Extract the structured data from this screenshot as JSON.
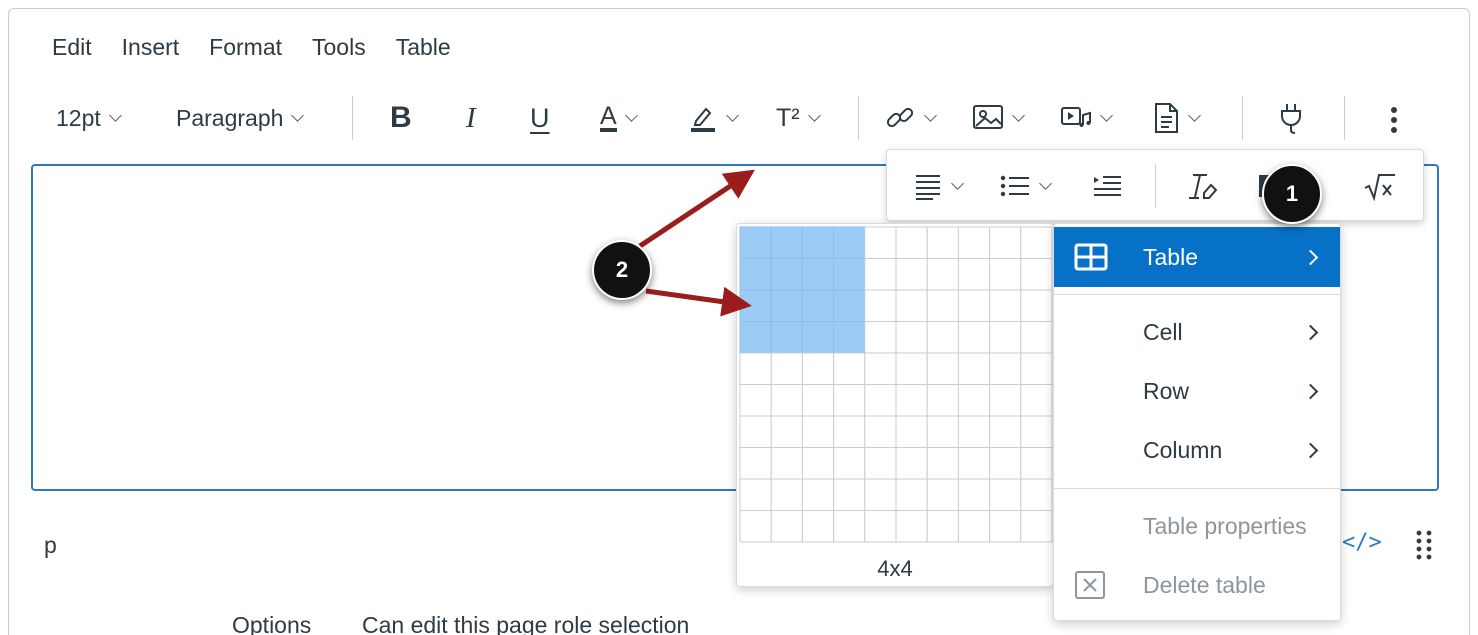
{
  "menubar": {
    "items": [
      "Edit",
      "Insert",
      "Format",
      "Tools",
      "Table"
    ]
  },
  "toolbar": {
    "font_size": "12pt",
    "block_format": "Paragraph",
    "bold_label": "B",
    "italic_label": "I",
    "underline_label": "U",
    "font_color_label": "A",
    "superscript_label": "T²",
    "underline_color": "#2d3b45",
    "more_indicator_color": "#2b7abc"
  },
  "status": {
    "element_path": "p",
    "html_toggle": "</>"
  },
  "table_picker": {
    "selection_label": "4x4",
    "rows": 10,
    "cols": 10,
    "selected_rows": 4,
    "selected_cols": 4,
    "highlight_color": "#9ccbf6"
  },
  "table_menu": {
    "items": [
      {
        "label": "Table",
        "has_submenu": true,
        "active": true,
        "disabled": false
      },
      {
        "label": "Cell",
        "has_submenu": true,
        "active": false,
        "disabled": false
      },
      {
        "label": "Row",
        "has_submenu": true,
        "active": false,
        "disabled": false
      },
      {
        "label": "Column",
        "has_submenu": true,
        "active": false,
        "disabled": false
      },
      {
        "label": "Table properties",
        "has_submenu": false,
        "active": false,
        "disabled": true
      },
      {
        "label": "Delete table",
        "has_submenu": false,
        "active": false,
        "disabled": true
      }
    ],
    "active_color": "#0770c7"
  },
  "below_editor": {
    "left_text": "Options",
    "right_text": "Can edit this page role selection"
  },
  "callouts": {
    "badge_1": "1",
    "badge_2": "2",
    "arrow_color": "#9b1c1c"
  },
  "accent_color": "#2b7abc"
}
